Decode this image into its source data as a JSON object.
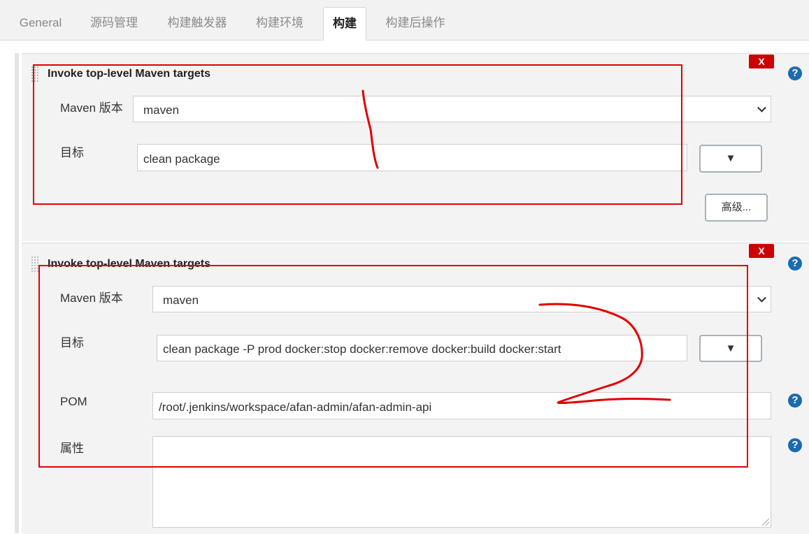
{
  "tabs": [
    {
      "label": "General"
    },
    {
      "label": "源码管理"
    },
    {
      "label": "构建触发器"
    },
    {
      "label": "构建环境"
    },
    {
      "label": "构建"
    },
    {
      "label": "构建后操作"
    }
  ],
  "active_tab": "构建",
  "steps": [
    {
      "title": "Invoke top-level Maven targets",
      "delete_label": "X",
      "help_label": "?",
      "maven_version_label": "Maven 版本",
      "maven_version_value": "maven",
      "goals_label": "目标",
      "goals_value": "clean package",
      "expand_icon": "▼",
      "advanced_label": "高级..."
    },
    {
      "title": "Invoke top-level Maven targets",
      "delete_label": "X",
      "help_label": "?",
      "maven_version_label": "Maven 版本",
      "maven_version_value": "maven",
      "goals_label": "目标",
      "goals_value": "clean package -P prod docker:stop docker:remove  docker:build  docker:start",
      "expand_icon": "▼",
      "pom_label": "POM",
      "pom_value": "/root/.jenkins/workspace/afan-admin/afan-admin-api",
      "properties_label": "属性",
      "properties_value": ""
    }
  ],
  "colors": {
    "annotation": "#e00000",
    "delete_button": "#cc0000",
    "help_icon": "#1c6ab0"
  }
}
